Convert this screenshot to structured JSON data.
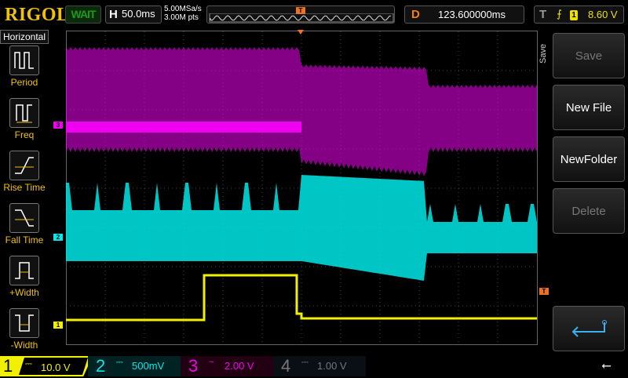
{
  "header": {
    "brand": "RIGOL",
    "run_status": "WAIT",
    "horizontal_label": "H",
    "timebase": "50.0ms",
    "sample_rate": "5.00MSa/s",
    "memory_depth": "3.00M pts",
    "trigger_marker": "T",
    "delay_label": "D",
    "delay": "123.600000ms",
    "trigger_label": "T",
    "trigger_edge": "rising",
    "trigger_source": "1",
    "trigger_level": "8.60 V"
  },
  "sidebar": {
    "title": "Horizontal",
    "items": [
      {
        "label": "Period",
        "icon": "period-icon"
      },
      {
        "label": "Freq",
        "icon": "freq-icon"
      },
      {
        "label": "Rise Time",
        "icon": "rise-time-icon"
      },
      {
        "label": "Fall Time",
        "icon": "fall-time-icon"
      },
      {
        "label": "+Width",
        "icon": "positive-width-icon"
      },
      {
        "label": "-Width",
        "icon": "negative-width-icon"
      }
    ]
  },
  "menu": {
    "tab": "Save",
    "buttons": [
      {
        "label": "Save",
        "enabled": false
      },
      {
        "label": "New File",
        "enabled": true
      },
      {
        "label": "NewFolder",
        "enabled": true
      },
      {
        "label": "Delete",
        "enabled": false
      }
    ],
    "return_icon": "return-arrow-icon"
  },
  "channels": [
    {
      "num": "1",
      "coupling": "DC",
      "scale": "10.0 V",
      "color": "#f0f000",
      "marker": "1"
    },
    {
      "num": "2",
      "coupling": "DC",
      "scale": "500mV",
      "color": "#00e8e8",
      "marker": "2"
    },
    {
      "num": "3",
      "coupling": "AC",
      "scale": "2.00 V",
      "color": "#f000f0",
      "marker": "3"
    },
    {
      "num": "4",
      "coupling": "DC",
      "scale": "1.00 V",
      "color": "#777777"
    }
  ],
  "trigger_level_marker": "T",
  "usb_icon": "usb-icon"
}
